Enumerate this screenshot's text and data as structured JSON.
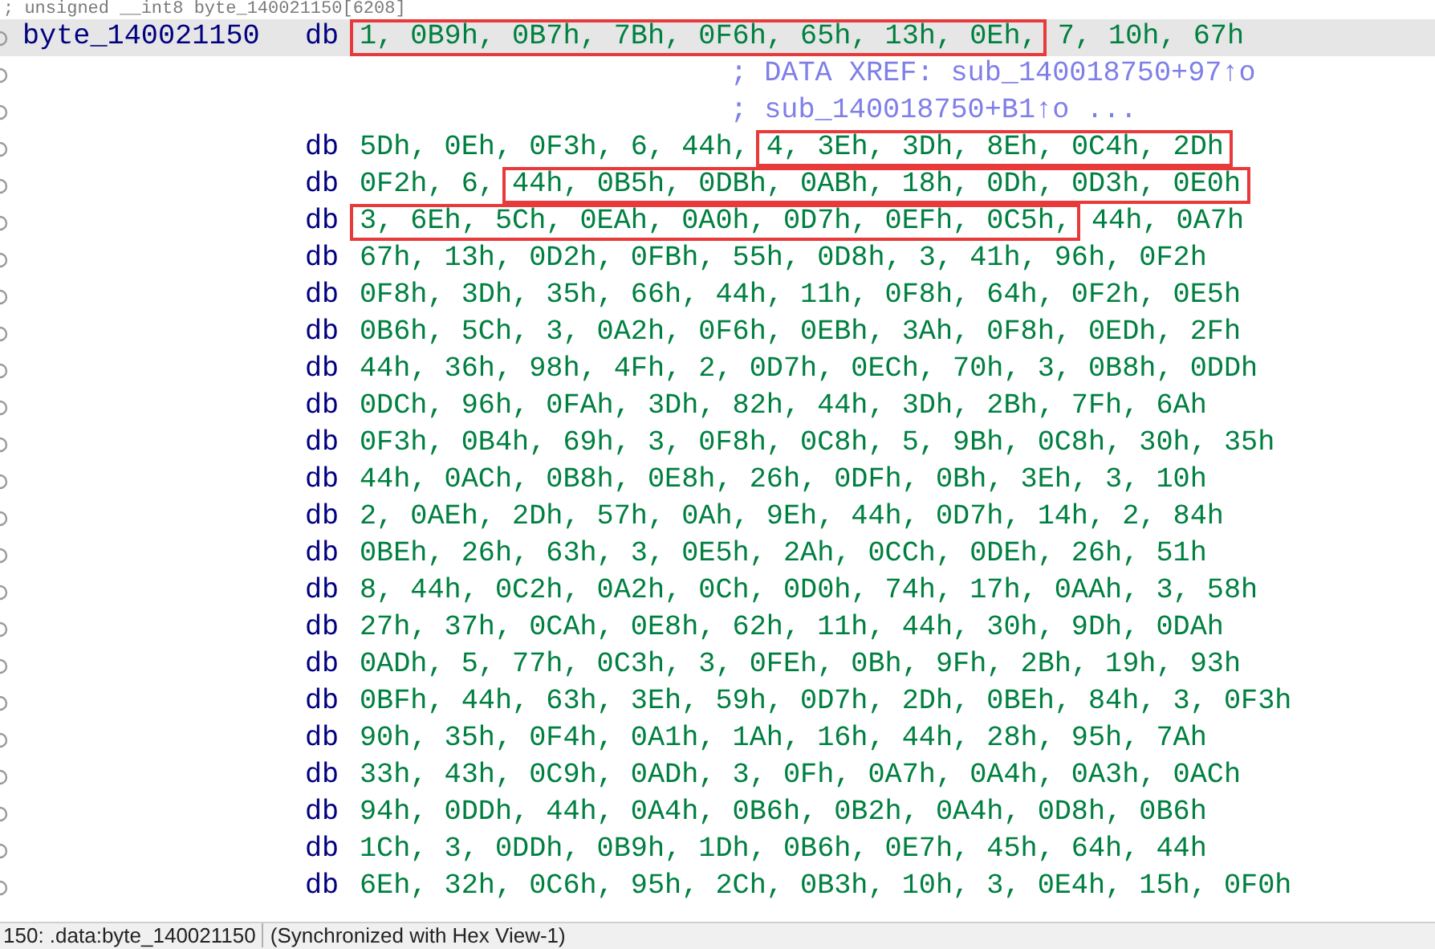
{
  "listing": {
    "rows": [
      {
        "kind": "header",
        "text": "; unsigned __int8 byte_140021150[6208]"
      },
      {
        "kind": "label",
        "highlighted": true,
        "label": "byte_140021150",
        "directive": "db",
        "operands": [
          {
            "text": "1, 0B9h, 0B7h, 7Bh, 0F6h, 65h, 13h, 0Eh,",
            "boxed": true
          },
          {
            "text": " 7, 10h, 67h",
            "boxed": false
          }
        ]
      },
      {
        "kind": "comment",
        "text": "; DATA XREF: sub_140018750+97↑o"
      },
      {
        "kind": "comment",
        "text": "; sub_140018750+B1↑o ..."
      },
      {
        "kind": "data",
        "directive": "db",
        "operands": [
          {
            "text": "5Dh, 0Eh, 0F3h, 6, 44h, ",
            "boxed": false
          },
          {
            "text": "4, 3Eh, 3Dh, 8Eh, 0C4h, 2Dh",
            "boxed": true
          }
        ]
      },
      {
        "kind": "data",
        "directive": "db",
        "operands": [
          {
            "text": "0F2h, 6, ",
            "boxed": false
          },
          {
            "text": "44h, 0B5h, 0DBh, 0ABh, 18h, 0Dh, 0D3h, 0E0h",
            "boxed": true
          }
        ]
      },
      {
        "kind": "data",
        "directive": "db",
        "operands": [
          {
            "text": "3, 6Eh, 5Ch, 0EAh, 0A0h, 0D7h, 0EFh, 0C5h,",
            "boxed": true
          },
          {
            "text": " 44h, 0A7h",
            "boxed": false
          }
        ]
      },
      {
        "kind": "data",
        "directive": "db",
        "operands": [
          {
            "text": "67h, 13h, 0D2h, 0FBh, 55h, 0D8h, 3, 41h, 96h, 0F2h",
            "boxed": false
          }
        ]
      },
      {
        "kind": "data",
        "directive": "db",
        "operands": [
          {
            "text": "0F8h, 3Dh, 35h, 66h, 44h, 11h, 0F8h, 64h, 0F2h, 0E5h",
            "boxed": false
          }
        ]
      },
      {
        "kind": "data",
        "directive": "db",
        "operands": [
          {
            "text": "0B6h, 5Ch, 3, 0A2h, 0F6h, 0EBh, 3Ah, 0F8h, 0EDh, 2Fh",
            "boxed": false
          }
        ]
      },
      {
        "kind": "data",
        "directive": "db",
        "operands": [
          {
            "text": "44h, 36h, 98h, 4Fh, 2, 0D7h, 0ECh, 70h, 3, 0B8h, 0DDh",
            "boxed": false
          }
        ]
      },
      {
        "kind": "data",
        "directive": "db",
        "operands": [
          {
            "text": "0DCh, 96h, 0FAh, 3Dh, 82h, 44h, 3Dh, 2Bh, 7Fh, 6Ah",
            "boxed": false
          }
        ]
      },
      {
        "kind": "data",
        "directive": "db",
        "operands": [
          {
            "text": "0F3h, 0B4h, 69h, 3, 0F8h, 0C8h, 5, 9Bh, 0C8h, 30h, 35h",
            "boxed": false
          }
        ]
      },
      {
        "kind": "data",
        "directive": "db",
        "operands": [
          {
            "text": "44h, 0ACh, 0B8h, 0E8h, 26h, 0DFh, 0Bh, 3Eh, 3, 10h",
            "boxed": false
          }
        ]
      },
      {
        "kind": "data",
        "directive": "db",
        "operands": [
          {
            "text": "2, 0AEh, 2Dh, 57h, 0Ah, 9Eh, 44h, 0D7h, 14h, 2, 84h",
            "boxed": false
          }
        ]
      },
      {
        "kind": "data",
        "directive": "db",
        "operands": [
          {
            "text": "0BEh, 26h, 63h, 3, 0E5h, 2Ah, 0CCh, 0DEh, 26h, 51h",
            "boxed": false
          }
        ]
      },
      {
        "kind": "data",
        "directive": "db",
        "operands": [
          {
            "text": "8, 44h, 0C2h, 0A2h, 0Ch, 0D0h, 74h, 17h, 0AAh, 3, 58h",
            "boxed": false
          }
        ]
      },
      {
        "kind": "data",
        "directive": "db",
        "operands": [
          {
            "text": "27h, 37h, 0CAh, 0E8h, 62h, 11h, 44h, 30h, 9Dh, 0DAh",
            "boxed": false
          }
        ]
      },
      {
        "kind": "data",
        "directive": "db",
        "operands": [
          {
            "text": "0ADh, 5, 77h, 0C3h, 3, 0FEh, 0Bh, 9Fh, 2Bh, 19h, 93h",
            "boxed": false
          }
        ]
      },
      {
        "kind": "data",
        "directive": "db",
        "operands": [
          {
            "text": "0BFh, 44h, 63h, 3Eh, 59h, 0D7h, 2Dh, 0BEh, 84h, 3, 0F3h",
            "boxed": false
          }
        ]
      },
      {
        "kind": "data",
        "directive": "db",
        "operands": [
          {
            "text": "90h, 35h, 0F4h, 0A1h, 1Ah, 16h, 44h, 28h, 95h, 7Ah",
            "boxed": false
          }
        ]
      },
      {
        "kind": "data",
        "directive": "db",
        "operands": [
          {
            "text": "33h, 43h, 0C9h, 0ADh, 3, 0Fh, 0A7h, 0A4h, 0A3h, 0ACh",
            "boxed": false
          }
        ]
      },
      {
        "kind": "data",
        "directive": "db",
        "operands": [
          {
            "text": "94h, 0DDh, 44h, 0A4h, 0B6h, 0B2h, 0A4h, 0D8h, 0B6h",
            "boxed": false
          }
        ]
      },
      {
        "kind": "data",
        "directive": "db",
        "operands": [
          {
            "text": "1Ch, 3, 0DDh, 0B9h, 1Dh, 0B6h, 0E7h, 45h, 64h, 44h",
            "boxed": false
          }
        ]
      },
      {
        "kind": "data",
        "directive": "db",
        "operands": [
          {
            "text": "6Eh, 32h, 0C6h, 95h, 2Ch, 0B3h, 10h, 3, 0E4h, 15h, 0F0h",
            "boxed": false
          }
        ]
      }
    ]
  },
  "status_bar": {
    "location": "150: .data:byte_140021150",
    "sync": "(Synchronized with Hex View-1)"
  }
}
